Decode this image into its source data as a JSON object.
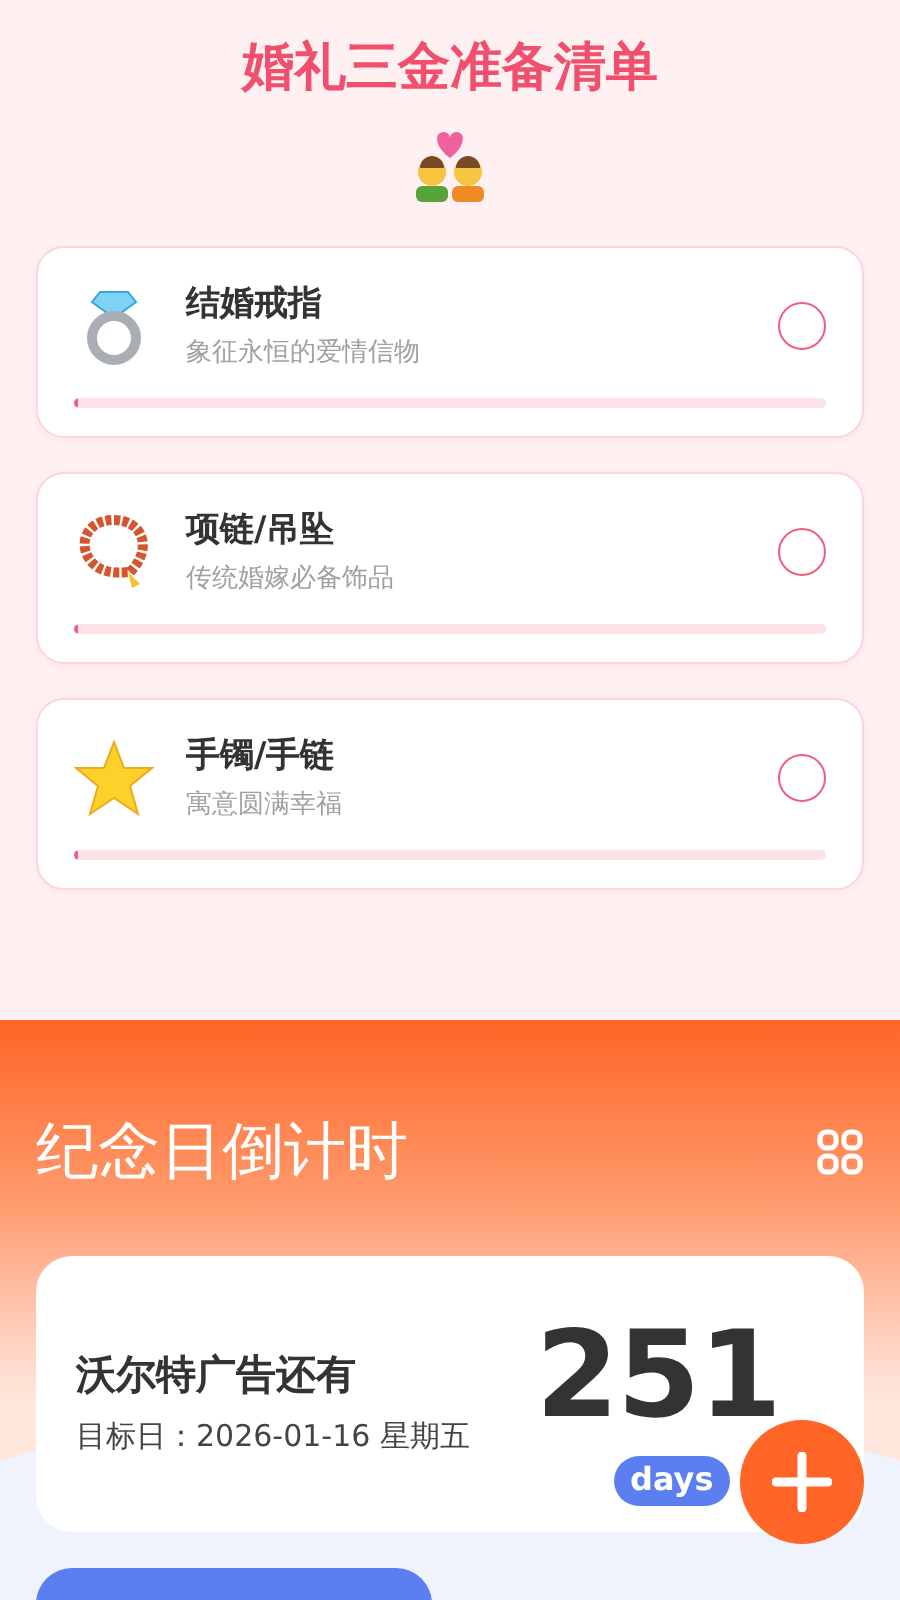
{
  "header": {
    "title": "婚礼三金准备清单"
  },
  "checklist": [
    {
      "kind": "ring",
      "title": "结婚戒指",
      "subtitle": "象征永恒的爱情信物",
      "checked": false,
      "level": 0
    },
    {
      "kind": "beads",
      "title": "项链/吊坠",
      "subtitle": "传统婚嫁必备饰品",
      "checked": false,
      "level": 0
    },
    {
      "kind": "star",
      "title": "手镯/手链",
      "subtitle": "寓意圆满幸福",
      "checked": false,
      "level": 0
    }
  ],
  "countdown": {
    "title": "纪念日倒计时",
    "event": {
      "name": "沃尔特广告还有",
      "date": "目标日：2026-01-16 星期五",
      "days": "251",
      "unit": "days"
    }
  }
}
